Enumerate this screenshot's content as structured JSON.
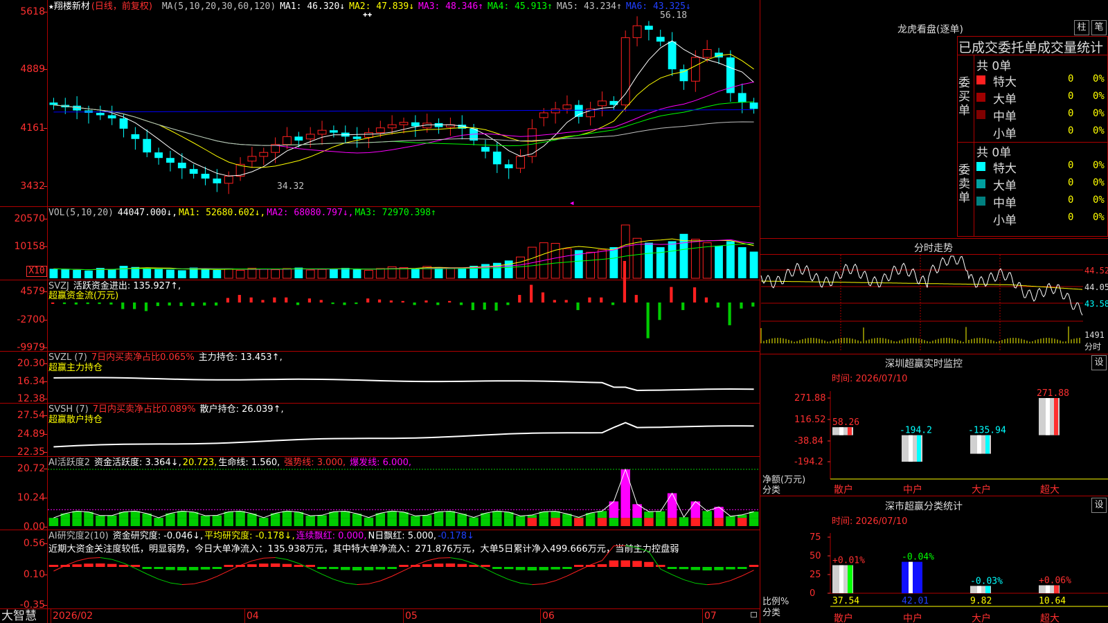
{
  "main": {
    "title_star": "★",
    "stock_name": "翔楼新材",
    "period": "(日线，前复权)",
    "ma_params": "MA(5,10,20,30,60,120)",
    "ma1": "MA1: 46.320↓",
    "ma2": "MA2: 47.839↓",
    "ma3": "MA3: 48.346↑",
    "ma4": "MA4: 45.913↑",
    "ma5": "MA5: 43.234↑",
    "ma6": "MA6: 43.325↓",
    "hi_label": "56.18",
    "lo_label": "34.32",
    "yticks": [
      "5618",
      "4889",
      "4161",
      "3432"
    ],
    "colors": {
      "up": "#ff2020",
      "down": "#00ffff",
      "ma1": "#ffffff",
      "ma2": "#ffff00",
      "ma3": "#ff00ff",
      "ma4": "#00ff00",
      "ma5": "#c0c0c0",
      "ma6": "#0000ff"
    }
  },
  "vol": {
    "label": "VOL(5,10,20)",
    "value": "44047.000↓,",
    "ma1": "MA1: 52680.602↓,",
    "ma2": "MA2: 68080.797↓,",
    "ma3": "MA3: 72970.398↑",
    "yticks": [
      "20570",
      "10158",
      "X10"
    ]
  },
  "svzj": {
    "label": "SVZJ",
    "text": "活跃资金进出: 135.927↑,",
    "name": "超赢资金流(万元)",
    "yticks": [
      "4579",
      "-2700",
      "-9979"
    ]
  },
  "svzl": {
    "label": "SVZL (7)",
    "pct": "7日内买卖净占比0.065%",
    "hold": "主力持仓: 13.453↑,",
    "name": "超赢主力持仓",
    "yticks": [
      "20.30",
      "16.34",
      "12.38"
    ]
  },
  "svsh": {
    "label": "SVSH (7)",
    "pct": "7日内买卖净占比0.089%",
    "hold": "散户持仓: 26.039↑,",
    "name": "超赢散户持仓",
    "yticks": [
      "27.54",
      "24.89",
      "22.35"
    ]
  },
  "ai1": {
    "label": "AI活跃度2",
    "a": "资金活跃度: 3.364↓,",
    "b": "20.723,",
    "c": "生命线: 1.560,",
    "d": "强势线: 3.000,",
    "e": "爆发线: 6.000,",
    "yticks": [
      "20.72",
      "10.24",
      "0.00"
    ]
  },
  "ai2": {
    "label": "AI研究度2(10)",
    "a": "资金研究度: -0.046↓,",
    "b": "平均研究度: -0.178↓,",
    "c": "连续飘红: 0.000,",
    "d": "N日飘红: 5.000,",
    "e": "-0.178↓",
    "comment": "近期大资金关注度较低，明显弱势，今日大单净流入：135.938万元，其中特大单净流入：271.876万元，大单5日累计净入499.666万元，当前主力控盘弱",
    "yticks": [
      "0.56",
      "0.10",
      "-0.35"
    ]
  },
  "bottom": {
    "brand": "大智慧",
    "dates": [
      "2026/02",
      "04",
      "05",
      "06",
      "07"
    ]
  },
  "lhb": {
    "title": "龙虎看盘(逐单)",
    "btn1": "柱",
    "btn2": "笔",
    "tabs": "已成交委托单成交量统计",
    "buy_label": "委买单",
    "sell_label": "委卖单",
    "buy_total": "共 0单",
    "sell_total": "共 0单",
    "rows": [
      {
        "name": "特大",
        "n": "0",
        "p": "0%"
      },
      {
        "name": "大单",
        "n": "0",
        "p": "0%"
      },
      {
        "name": "中单",
        "n": "0",
        "p": "0%"
      },
      {
        "name": "小单",
        "n": "0",
        "p": "0%"
      }
    ]
  },
  "fs": {
    "title": "分时走势",
    "yticks": [
      "44.52",
      "44.05",
      "43.58"
    ],
    "vol": "1491",
    "vol_unit": "分时"
  },
  "monitor": {
    "title": "深圳超赢实时监控",
    "btn": "设",
    "date": "时间: 2026/07/10",
    "yticks": [
      "271.88",
      "116.52",
      "-38.84",
      "-194.2"
    ],
    "ylab1": "净额(万元)",
    "ylab2": "分类",
    "cats": [
      "散户",
      "中户",
      "大户",
      "超大"
    ],
    "values": [
      58.26,
      -194.2,
      -135.94,
      271.88
    ],
    "labels": [
      "58.26",
      "-194.2",
      "-135.94",
      "271.88"
    ]
  },
  "classify": {
    "title": "深市超赢分类统计",
    "btn": "设",
    "date": "时间: 2026/07/10",
    "yticks": [
      "75",
      "50",
      "25",
      "0"
    ],
    "ylab1": "比例%",
    "ylab2": "分类",
    "cats": [
      "散户",
      "中户",
      "大户",
      "超大"
    ],
    "values": [
      37.54,
      42.01,
      9.82,
      10.64
    ],
    "value_labels": [
      "37.54",
      "42.01",
      "9.82",
      "10.64"
    ],
    "deltas": [
      "+0.01%",
      "-0.04%",
      "-0.03%",
      "+0.06%"
    ]
  },
  "chart_data": [
    {
      "type": "candlestick",
      "title": "翔楼新材 (日线，前复权)",
      "x": [
        "2026/02",
        "04",
        "05",
        "06",
        "07"
      ],
      "ylim": [
        34.32,
        56.18
      ],
      "close_approx": [
        44.5,
        44.2,
        43.8,
        43.5,
        43.2,
        42.8,
        41.5,
        40.2,
        38.5,
        37.8,
        37.2,
        36.5,
        35.8,
        35.2,
        34.6,
        35.5,
        37.0,
        38.0,
        38.5,
        39.5,
        40.5,
        40.0,
        40.8,
        41.3,
        41.0,
        40.5,
        40.2,
        41.0,
        41.6,
        42.0,
        42.3,
        41.8,
        42.2,
        41.7,
        42.0,
        41.5,
        40.0,
        38.6,
        37.0,
        36.5,
        38.0,
        41.5,
        43.5,
        44.0,
        44.5,
        43.0,
        44.0,
        45.0,
        44.5,
        53.0,
        54.5,
        54.0,
        52.5,
        49.0,
        47.5,
        50.5,
        51.5,
        50.5,
        46.0,
        44.8,
        44.0
      ]
    },
    {
      "type": "bar",
      "title": "VOL(5,10,20)",
      "ylim": [
        0,
        20570
      ],
      "values": [
        3200,
        3000,
        2800,
        2600,
        3500,
        3000,
        4200,
        3800,
        3300,
        3100,
        2900,
        2700,
        3600,
        3000,
        2800,
        3200,
        2700,
        3400,
        3100,
        2900,
        3300,
        3600,
        2800,
        3000,
        3200,
        3500,
        3000,
        2700,
        3300,
        3900,
        3600,
        3300,
        4000,
        3700,
        3300,
        3500,
        4200,
        4800,
        5200,
        6000,
        7200,
        10500,
        12000,
        11800,
        10000,
        9500,
        8800,
        9600,
        10500,
        18000,
        13500,
        12000,
        10500,
        12500,
        15000,
        13200,
        12000,
        11000,
        12500,
        10500,
        9000
      ]
    },
    {
      "type": "bar",
      "title": "监控 净额(万元)",
      "categories": [
        "散户",
        "中户",
        "大户",
        "超大"
      ],
      "values": [
        58.26,
        -194.2,
        -135.94,
        271.88
      ],
      "ylim": [
        -194.2,
        271.88
      ]
    },
    {
      "type": "bar",
      "title": "分类统计 比例%",
      "categories": [
        "散户",
        "中户",
        "大户",
        "超大"
      ],
      "values": [
        37.54,
        42.01,
        9.82,
        10.64
      ],
      "ylim": [
        0,
        75
      ]
    }
  ]
}
